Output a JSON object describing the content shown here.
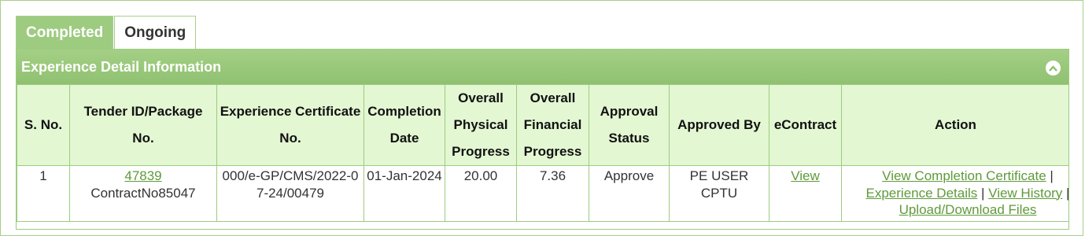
{
  "tabs": {
    "completed": "Completed",
    "ongoing": "Ongoing"
  },
  "panel": {
    "title": "Experience Detail Information"
  },
  "columns": {
    "s_no": "S. No.",
    "tender_id": "Tender ID/Package No.",
    "certificate_no": "Experience Certificate No.",
    "completion_date": "Completion Date",
    "physical_progress": "Overall Physical Progress",
    "financial_progress": "Overall Financial Progress",
    "approval_status": "Approval Status",
    "approved_by": "Approved By",
    "econtract": "eContract",
    "action": "Action"
  },
  "rows": [
    {
      "s_no": "1",
      "tender_id": "47839",
      "package_no": "ContractNo85047",
      "certificate_no": "000/e-GP/CMS/2022-07-24/00479",
      "completion_date": "01-Jan-2024",
      "physical_progress": "20.00",
      "financial_progress": "7.36",
      "approval_status": "Approve",
      "approved_by": "PE USER CPTU",
      "econtract_link": "View",
      "actions": {
        "view_certificate": "View Completion Certificate",
        "experience_details": "Experience Details",
        "separator": "|",
        "view_history": "View History",
        "upload_download": "Upload/Download Files"
      }
    }
  ],
  "colors": {
    "accent": "#9dcb80",
    "header_bg": "#e3f7d2",
    "link": "#5f9a3a"
  },
  "icons": {
    "collapse": "chevron-up-circle-icon"
  }
}
